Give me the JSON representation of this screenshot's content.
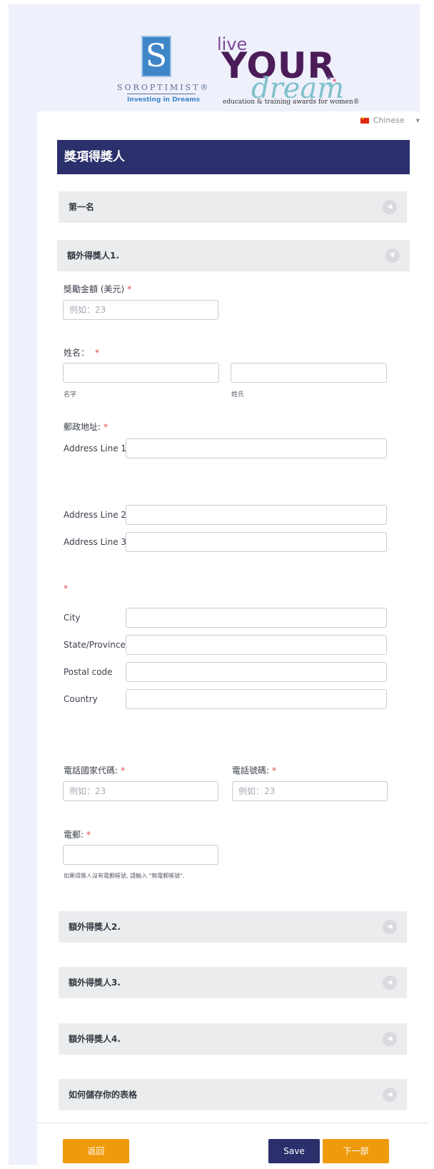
{
  "header": {
    "soroptimist_logo": {
      "letter": "S",
      "wordmark": "SOROPTIMIST®",
      "tagline": "Investing in Dreams"
    },
    "live_your_dream_logo": {
      "live": "live",
      "your": "YOUR",
      "dream": "dream",
      "tagline": "education & training awards for women®"
    }
  },
  "language": {
    "selected": "Chinese"
  },
  "form": {
    "title": "獎項得獎人",
    "panels": {
      "first_place": "第一名",
      "additional_1": "額外得獎人1.",
      "additional_2": "額外得獎人2.",
      "additional_3": "額外得獎人3.",
      "additional_4": "額外得獎人4.",
      "save_form": "如何儲存你的表格"
    },
    "award_amount": {
      "label": "獎勵金額 (美元)",
      "placeholder": "例如：23"
    },
    "name": {
      "label": "姓名：",
      "first_sub": "名字",
      "last_sub": "姓氏"
    },
    "postal_address": {
      "label": "郵政地址:",
      "line1": "Address Line 1",
      "line2": "Address Line 2",
      "line3": "Address Line 3",
      "city": "City",
      "state": "State/Province",
      "postal_code": "Postal code",
      "country": "Country"
    },
    "phone_country_code": {
      "label": "電話國家代碼:",
      "placeholder": "例如：23"
    },
    "phone_number": {
      "label": "電話號碼:",
      "placeholder": "例如：23"
    },
    "email": {
      "label": "電郵:",
      "hint": "如果得獎人沒有電郵帳號, 請輸入 \"無電郵帳號\"."
    },
    "required_marker": "*"
  },
  "footer": {
    "back": "返回",
    "save": "Save",
    "next": "下一部"
  },
  "colors": {
    "title_bar": "#2b2f6b",
    "save_button": "#2b2f6b",
    "action_button": "#ef9a0d",
    "required": "#e2454b"
  }
}
